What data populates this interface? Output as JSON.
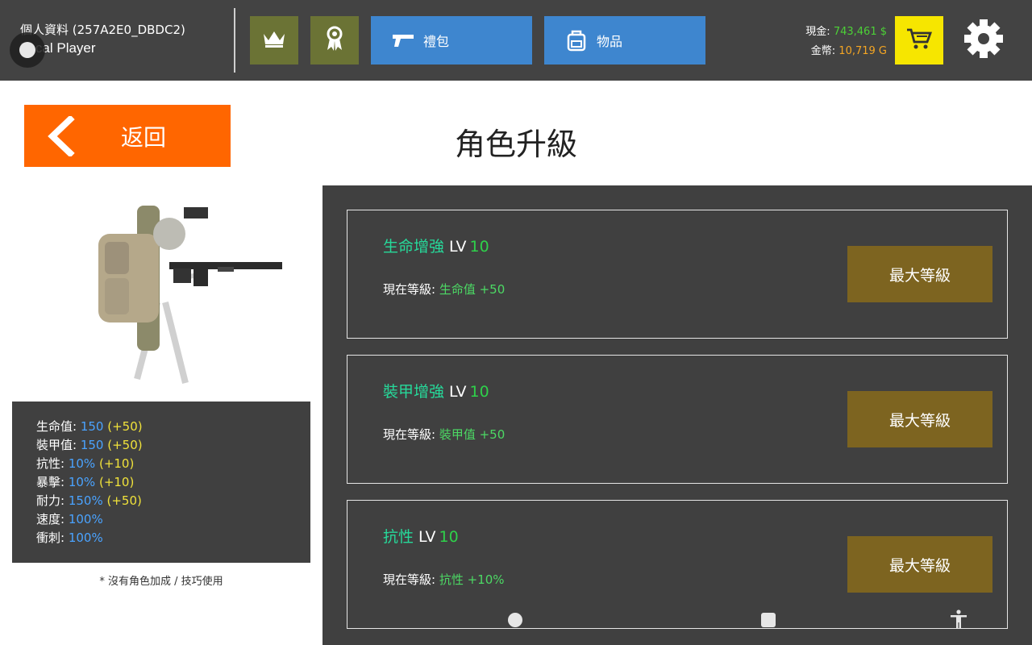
{
  "header": {
    "profile_title": "個人資料 (257A2E0_DBDC2)",
    "profile_name": "Local Player",
    "gift_label": "禮包",
    "items_label": "物品",
    "cash_label": "現金:",
    "cash_value": "743,461 $",
    "gold_label": "金幣:",
    "gold_value": "10,719 G",
    "icons": [
      "crown-icon",
      "ribbon-icon",
      "pistol-icon",
      "backpack-icon",
      "cart-icon",
      "gear-icon"
    ],
    "colors": {
      "bar": "#434343",
      "olive": "#6b7335",
      "blue": "#3e86cf",
      "cart": "#f6e600",
      "cash": "#4cd137",
      "gold": "#f5a623"
    }
  },
  "back": {
    "label": "返回",
    "color": "#ff6600"
  },
  "page_title": "角色升級",
  "stats": [
    {
      "label": "生命值:",
      "value": "150",
      "bonus": "(+50)"
    },
    {
      "label": "裝甲值:",
      "value": "150",
      "bonus": "(+50)"
    },
    {
      "label": "抗性:",
      "value": "10%",
      "bonus": "(+10)"
    },
    {
      "label": "暴擊:",
      "value": "10%",
      "bonus": "(+10)"
    },
    {
      "label": "耐力:",
      "value": "150%",
      "bonus": "(+50)"
    },
    {
      "label": "速度:",
      "value": "100%",
      "bonus": ""
    },
    {
      "label": "衝刺:",
      "value": "100%",
      "bonus": ""
    }
  ],
  "note": "* 沒有角色加成 / 技巧使用",
  "upgrades": [
    {
      "name": "生命增強",
      "lv_label": "LV",
      "level": "10",
      "current_label": "現在等級:",
      "current_value": "生命值 +50",
      "button": "最大等級"
    },
    {
      "name": "裝甲增強",
      "lv_label": "LV",
      "level": "10",
      "current_label": "現在等級:",
      "current_value": "裝甲值 +50",
      "button": "最大等級"
    },
    {
      "name": "抗性",
      "lv_label": "LV",
      "level": "10",
      "current_label": "現在等級:",
      "current_value": "抗性 +10%",
      "button": "最大等級"
    }
  ],
  "nav_icons": [
    "home-circle-icon",
    "recents-square-icon",
    "accessibility-icon"
  ]
}
